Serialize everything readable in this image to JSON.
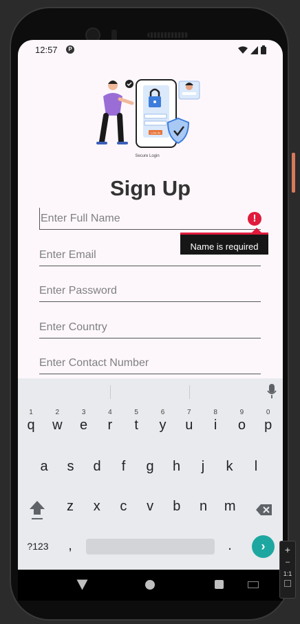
{
  "status_bar": {
    "time": "12:57",
    "icons": [
      "data-saver-icon",
      "wifi-icon",
      "signal-icon",
      "battery-icon"
    ]
  },
  "hero": {
    "caption": "Secure Login",
    "button_text": "LOG IN"
  },
  "form": {
    "title": "Sign Up",
    "fields": [
      {
        "placeholder": "Enter Full Name",
        "value": ""
      },
      {
        "placeholder": "Enter Email",
        "value": ""
      },
      {
        "placeholder": "Enter Password",
        "value": ""
      },
      {
        "placeholder": "Enter Country",
        "value": ""
      },
      {
        "placeholder": "Enter Contact Number",
        "value": ""
      }
    ],
    "error": {
      "message": "Name is required",
      "color": "#e01b3b"
    }
  },
  "keyboard": {
    "row1": [
      {
        "key": "q",
        "hint": "1"
      },
      {
        "key": "w",
        "hint": "2"
      },
      {
        "key": "e",
        "hint": "3"
      },
      {
        "key": "r",
        "hint": "4"
      },
      {
        "key": "t",
        "hint": "5"
      },
      {
        "key": "y",
        "hint": "6"
      },
      {
        "key": "u",
        "hint": "7"
      },
      {
        "key": "i",
        "hint": "8"
      },
      {
        "key": "o",
        "hint": "9"
      },
      {
        "key": "p",
        "hint": "0"
      }
    ],
    "row2": [
      "a",
      "s",
      "d",
      "f",
      "g",
      "h",
      "j",
      "k",
      "l"
    ],
    "row3": [
      "z",
      "x",
      "c",
      "v",
      "b",
      "n",
      "m"
    ],
    "symbols_label": "?123",
    "comma": ",",
    "period": ".",
    "enter_icon": "chevron-right-icon",
    "accent": "#1ea7a0"
  },
  "emulator_panel": {
    "zoom_in": "+",
    "zoom_out": "–",
    "ratio": "1:1"
  }
}
